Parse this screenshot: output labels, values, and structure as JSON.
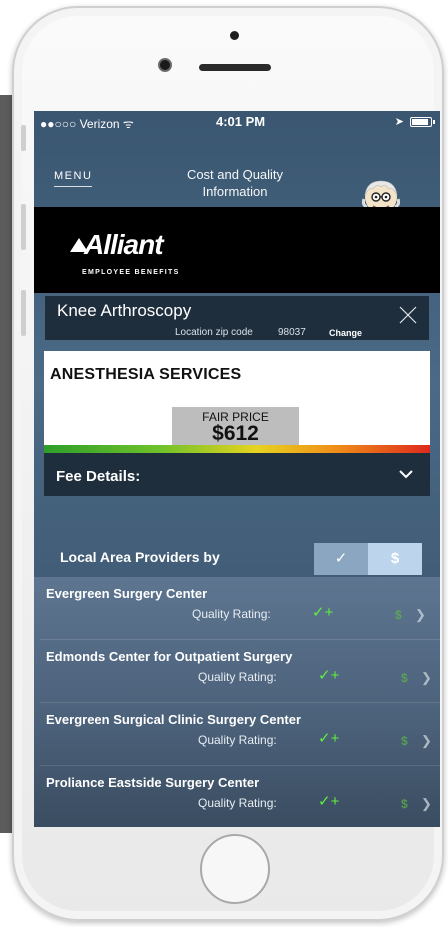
{
  "status_bar": {
    "carrier": "●●○○○ Verizon ᯤ",
    "time": "4:01 PM",
    "location_icon": "location-arrow-icon",
    "battery_icon": "battery-icon"
  },
  "nav": {
    "menu_label": "MENU",
    "title": "Cost and Quality Information",
    "avatar_icon": "professor-avatar-icon"
  },
  "brand": {
    "name": "Alliant",
    "tagline": "EMPLOYEE BENEFITS"
  },
  "procedure": {
    "name": "Knee Arthroscopy",
    "zip_label": "Location zip code",
    "zip_value": "98037",
    "change_label": "Change"
  },
  "price_card": {
    "title": "ANESTHESIA SERVICES",
    "fair_price_label": "FAIR PRICE",
    "fair_price_value": "$612"
  },
  "fee_details": {
    "label": "Fee Details:"
  },
  "providers": {
    "heading": "Local Area Providers by",
    "toggle_quality": "✓",
    "toggle_price": "$",
    "quality_label": "Quality Rating:",
    "items": [
      {
        "name": "Evergreen Surgery Center",
        "rating": "✓+",
        "price": "$"
      },
      {
        "name": "Edmonds Center for Outpatient Surgery",
        "rating": "✓+",
        "price": "$"
      },
      {
        "name": "Evergreen Surgical Clinic Surgery Center",
        "rating": "✓+",
        "price": "$"
      },
      {
        "name": "Proliance Eastside Surgery Center",
        "rating": "✓+",
        "price": "$"
      }
    ]
  },
  "colors": {
    "screen_bg": "#4a6a86",
    "dark_panel": "#1f2e3d",
    "rating_green": "#5ef03d",
    "toggle_quality_bg": "#8aa6c0",
    "toggle_price_bg": "#bcd5ec"
  }
}
